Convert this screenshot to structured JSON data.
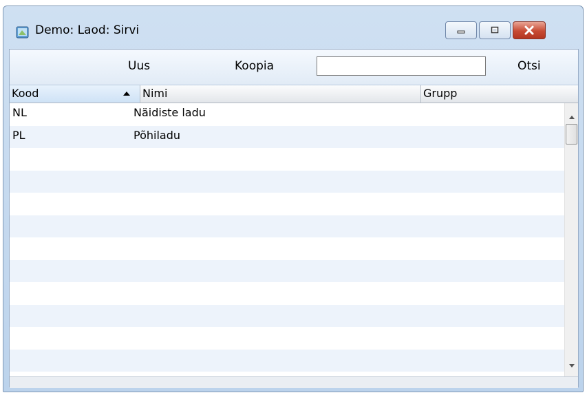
{
  "window": {
    "title": "Demo: Laod: Sirvi",
    "controls": {
      "minimize_icon": "minimize-icon",
      "maximize_icon": "maximize-icon",
      "close_icon": "close-icon"
    }
  },
  "toolbar": {
    "new_label": "Uus",
    "copy_label": "Koopia",
    "search_value": "",
    "search_label": "Otsi"
  },
  "table": {
    "columns": [
      "Kood",
      "Nimi",
      "Grupp"
    ],
    "sort_column": "Kood",
    "sort_direction": "ascending",
    "rows": [
      {
        "kood": "NL",
        "nimi": "Näidiste ladu",
        "grupp": ""
      },
      {
        "kood": "PL",
        "nimi": "Põhiladu",
        "grupp": ""
      }
    ]
  },
  "colors": {
    "row_stripe": "#edf3fb",
    "header_selected": "#cfe2f6",
    "close_button": "#c74a33"
  }
}
